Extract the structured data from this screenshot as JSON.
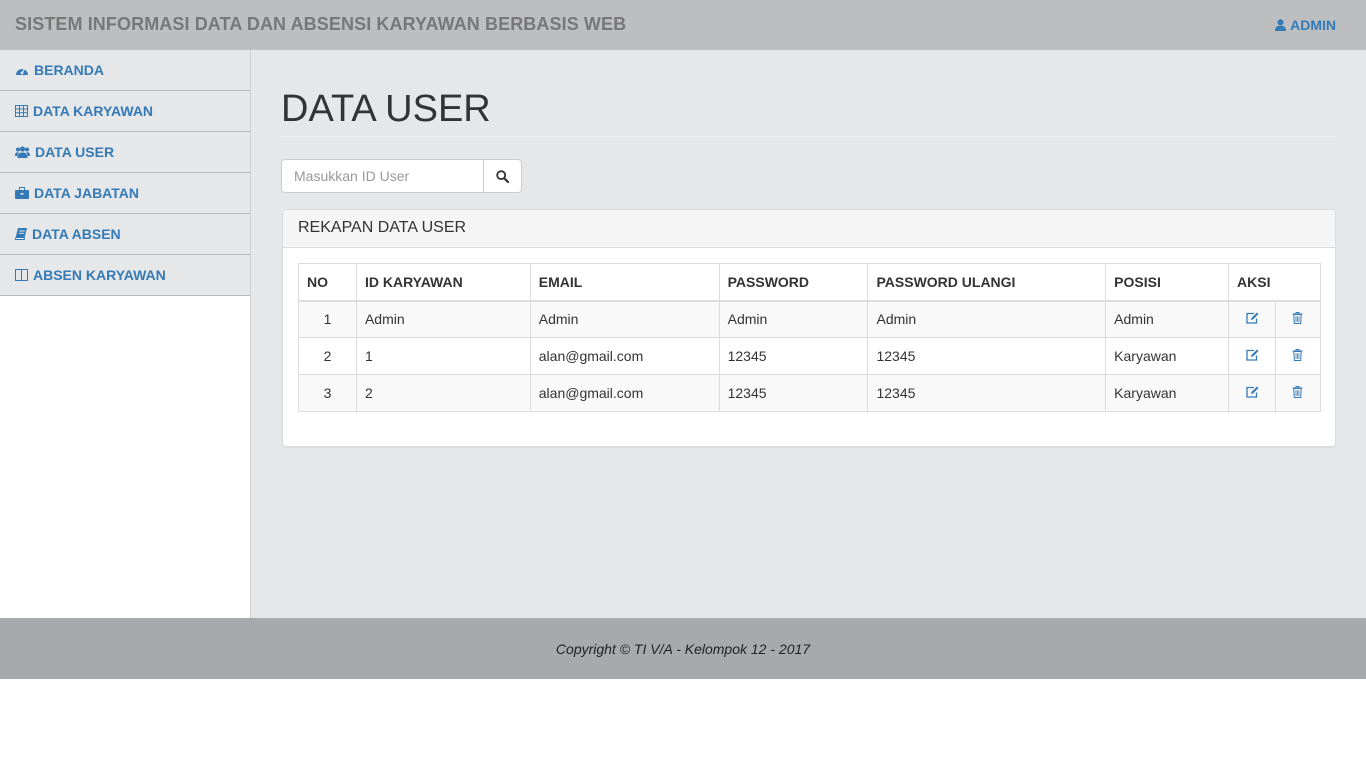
{
  "header": {
    "app_title": "SISTEM INFORMASI DATA DAN ABSENSI KARYAWAN BERBASIS WEB",
    "user_label": "ADMIN"
  },
  "sidebar": {
    "items": [
      {
        "label": "BERANDA",
        "icon": "dashboard-icon"
      },
      {
        "label": "DATA KARYAWAN",
        "icon": "table-icon"
      },
      {
        "label": "DATA USER",
        "icon": "users-icon"
      },
      {
        "label": "DATA JABATAN",
        "icon": "briefcase-icon"
      },
      {
        "label": "DATA ABSEN",
        "icon": "book-icon"
      },
      {
        "label": "ABSEN KARYAWAN",
        "icon": "columns-icon"
      }
    ]
  },
  "main": {
    "title": "DATA USER",
    "search": {
      "placeholder": "Masukkan ID User",
      "value": ""
    },
    "panel_title": "REKAPAN DATA USER",
    "table": {
      "headers": [
        "NO",
        "ID KARYAWAN",
        "EMAIL",
        "PASSWORD",
        "PASSWORD ULANGI",
        "POSISI",
        "AKSI"
      ],
      "rows": [
        {
          "no": "1",
          "id_karyawan": "Admin",
          "email": "Admin",
          "password": "Admin",
          "password_ulangi": "Admin",
          "posisi": "Admin"
        },
        {
          "no": "2",
          "id_karyawan": "1",
          "email": "alan@gmail.com",
          "password": "12345",
          "password_ulangi": "12345",
          "posisi": "Karyawan"
        },
        {
          "no": "3",
          "id_karyawan": "2",
          "email": "alan@gmail.com",
          "password": "12345",
          "password_ulangi": "12345",
          "posisi": "Karyawan"
        }
      ]
    }
  },
  "footer": {
    "copyright": "Copyright © TI V/A - Kelompok 12 - 2017"
  },
  "colors": {
    "link": "#337ab7",
    "navbar": "#bdbec0",
    "content_bg": "#e6e7e9",
    "footer": "#a8a9ac"
  }
}
